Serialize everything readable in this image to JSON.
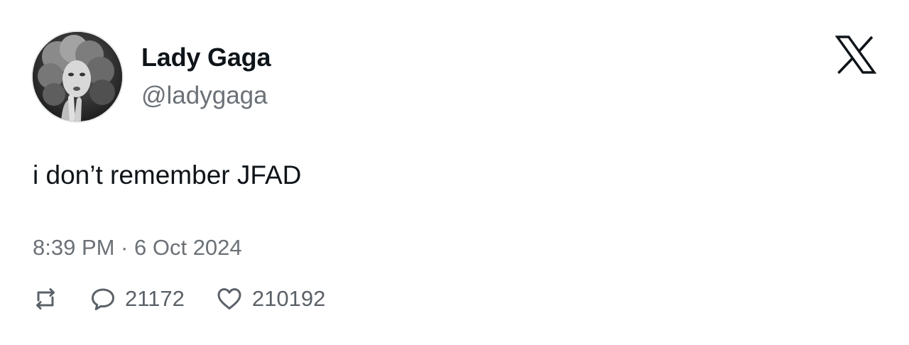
{
  "user": {
    "name": "Lady Gaga",
    "handle": "@ladygaga"
  },
  "brand": {
    "icon": "x-logo-icon",
    "color": "#0f1419"
  },
  "tweet": {
    "text": "i don’t remember JFAD",
    "timestamp": "8:39 PM · 6 Oct 2024"
  },
  "actions": {
    "retweet": {
      "icon": "retweet-icon"
    },
    "reply": {
      "icon": "reply-icon",
      "count": "21172"
    },
    "like": {
      "icon": "heart-icon",
      "count": "210192"
    }
  },
  "colors": {
    "text_primary": "#0f1419",
    "text_secondary": "#6b7177",
    "background": "#ffffff"
  }
}
